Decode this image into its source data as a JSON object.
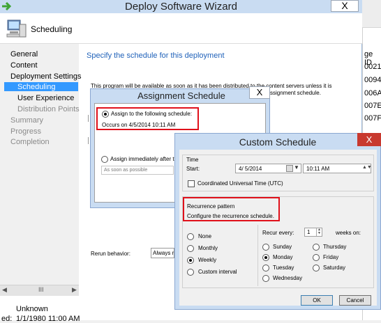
{
  "background": {
    "column_header": "ge ID",
    "ids": [
      "0021",
      "0094",
      "006A",
      "007E",
      "007F"
    ],
    "bottom_rows": [
      {
        "label": "",
        "value": "Unknown"
      },
      {
        "label": "ed:",
        "value": "1/1/1980 11:00 AM"
      }
    ]
  },
  "wizard": {
    "title": "Deploy Software Wizard",
    "close": "X",
    "header_title": "Scheduling",
    "nav": [
      {
        "label": "General",
        "state": "normal"
      },
      {
        "label": "Content",
        "state": "normal"
      },
      {
        "label": "Deployment Settings",
        "state": "normal"
      },
      {
        "label": "Scheduling",
        "state": "selected"
      },
      {
        "label": "User Experience",
        "state": "normal"
      },
      {
        "label": "Distribution Points",
        "state": "dim"
      },
      {
        "label": "Summary",
        "state": "dim"
      },
      {
        "label": "Progress",
        "state": "dim"
      },
      {
        "label": "Completion",
        "state": "dim"
      }
    ],
    "scroll_thumb": "III",
    "content_heading": "Specify the schedule for this deployment",
    "content_info_a": "This program will be available as soon as it has been distributed to the content servers unless it is",
    "content_info_b": "ssignment schedule.",
    "rerun_label": "Rerun behavior:",
    "rerun_value": "Always re"
  },
  "assignment": {
    "title": "Assignment Schedule",
    "close": "X",
    "option_schedule": "Assign to the following schedule:",
    "occurs": "Occurs on 4/5/2014 10:11 AM",
    "option_immediate": "Assign immediately after t",
    "immediate_placeholder": "As soon as possible"
  },
  "custom": {
    "title": "Custom Schedule",
    "close": "X",
    "time_group": "Time",
    "start_label": "Start:",
    "start_date": "4/  5/2014",
    "start_time": "10:11 AM",
    "utc_label": "Coordinated Universal Time (UTC)",
    "recurrence_title": "Recurrence pattern",
    "recurrence_desc": "Configure the recurrence schedule.",
    "patterns": [
      "None",
      "Monthly",
      "Weekly",
      "Custom interval"
    ],
    "selected_pattern": "Weekly",
    "recur_every_label": "Recur every:",
    "recur_every_value": "1",
    "weeks_on_label": "weeks on:",
    "days_col1": [
      "Sunday",
      "Monday",
      "Tuesday",
      "Wednesday"
    ],
    "days_col2": [
      "Thursday",
      "Friday",
      "Saturday"
    ],
    "selected_day": "Monday",
    "ok": "OK",
    "cancel": "Cancel"
  },
  "colors": {
    "title_bar": "#c9dcf2",
    "selection": "#3399ff",
    "highlight_box": "#e0101a",
    "link_blue": "#1f61b9",
    "close_red": "#c8392f"
  }
}
